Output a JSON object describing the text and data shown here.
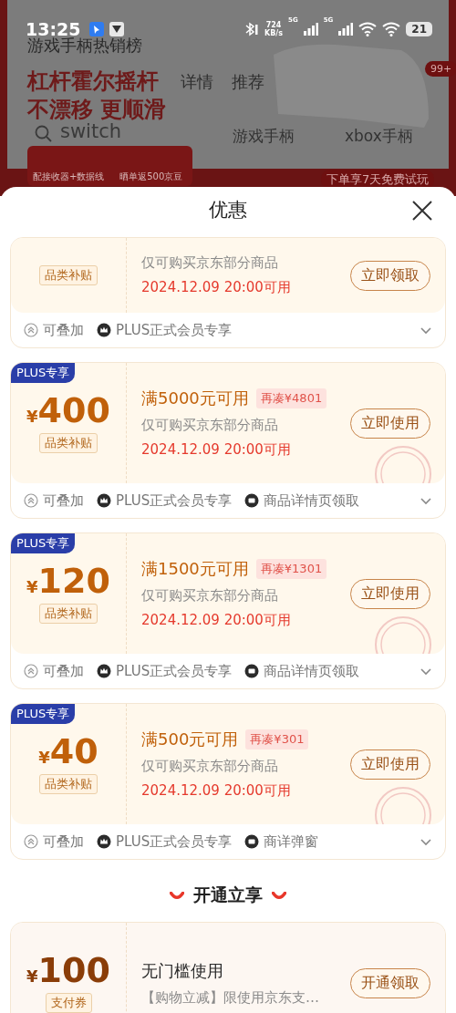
{
  "status_bar": {
    "time": "13:25",
    "speed": [
      "724",
      "KB/s"
    ],
    "networks": [
      "5G",
      "5G"
    ],
    "battery": "21"
  },
  "background_page": {
    "title": "游戏手柄热销榜",
    "headline": [
      "杠杆霍尔摇杆",
      "不漂移 更顺滑"
    ],
    "tabs": [
      "详情",
      "推荐"
    ],
    "search": "switch",
    "links": [
      "游戏手柄",
      "xbox手柄"
    ],
    "perks": [
      "配接收器+数据线",
      "晒单返500京豆"
    ],
    "badge": "99+",
    "trial": "下单享7天免费试玩"
  },
  "sheet": {
    "title": "优惠"
  },
  "coupons": [
    {
      "kind": "plus",
      "tag": "品类补贴",
      "description": "仅可购买京东部分商品",
      "date": "2024.12.09 20:00可用",
      "button": "立即领取",
      "claimed": false,
      "features": [
        {
          "kind": "stack",
          "text": "可叠加"
        },
        {
          "kind": "crown",
          "text": "PLUS正式会员专享"
        }
      ]
    },
    {
      "kind": "plus",
      "badge": "PLUS专享",
      "amount": "400",
      "currency": "¥",
      "tag": "品类补贴",
      "title": "满5000元可用",
      "gap": "再凑¥4801",
      "description": "仅可购买京东部分商品",
      "date": "2024.12.09 20:00可用",
      "button": "立即使用",
      "claimed": true,
      "features": [
        {
          "kind": "stack",
          "text": "可叠加"
        },
        {
          "kind": "crown",
          "text": "PLUS正式会员专享"
        },
        {
          "kind": "source",
          "text": "商品详情页领取"
        }
      ]
    },
    {
      "kind": "plus",
      "badge": "PLUS专享",
      "amount": "120",
      "currency": "¥",
      "tag": "品类补贴",
      "title": "满1500元可用",
      "gap": "再凑¥1301",
      "description": "仅可购买京东部分商品",
      "date": "2024.12.09 20:00可用",
      "button": "立即使用",
      "claimed": true,
      "features": [
        {
          "kind": "stack",
          "text": "可叠加"
        },
        {
          "kind": "crown",
          "text": "PLUS正式会员专享"
        },
        {
          "kind": "source",
          "text": "商品详情页领取"
        }
      ]
    },
    {
      "kind": "plus",
      "badge": "PLUS专享",
      "amount": "40",
      "currency": "¥",
      "tag": "品类补贴",
      "title": "满500元可用",
      "gap": "再凑¥301",
      "description": "仅可购买京东部分商品",
      "date": "2024.12.09 20:00可用",
      "button": "立即使用",
      "claimed": true,
      "features": [
        {
          "kind": "stack",
          "text": "可叠加"
        },
        {
          "kind": "crown",
          "text": "PLUS正式会员专享"
        },
        {
          "kind": "source",
          "text": "商详弹窗"
        }
      ]
    }
  ],
  "section_title": "开通立享",
  "member_coupons": [
    {
      "kind": "member",
      "amount": "100",
      "currency": "¥",
      "tag": "支付券",
      "title": "无门槛使用",
      "description": "【购物立减】限使用京东支…",
      "button": "开通领取"
    }
  ]
}
